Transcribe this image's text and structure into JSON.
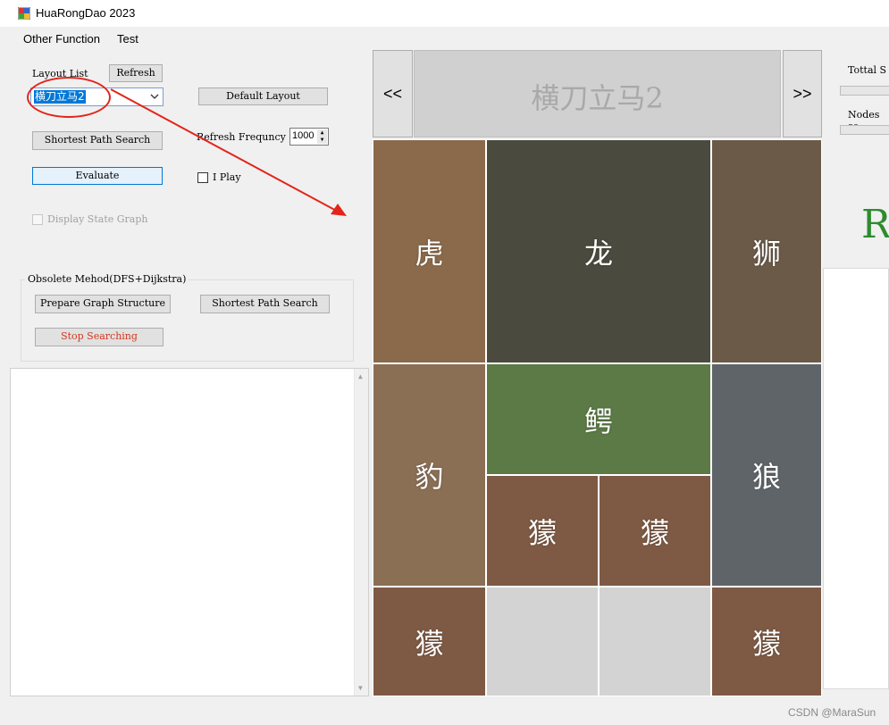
{
  "window": {
    "title": "HuaRongDao 2023"
  },
  "menu": {
    "items": [
      "Other Function",
      "Test"
    ]
  },
  "left": {
    "layout_list_label": "Layout List",
    "refresh_label": "Refresh",
    "layout_value": "横刀立马2",
    "default_layout_label": "Default Layout",
    "shortest_path_label": "Shortest Path Search",
    "refresh_freq_label": "Refresh Frequncy",
    "refresh_freq_value": "1000",
    "evaluate_label": "Evaluate",
    "iplay_label": "I Play",
    "display_state_label": "Display State Graph",
    "obsolete_group_label": "Obsolete Mehod(DFS+Dijkstra)",
    "prepare_graph_label": "Prepare Graph Structure",
    "shortest_path2_label": "Shortest Path Search",
    "stop_label": "Stop Searching"
  },
  "board": {
    "prev_label": "<<",
    "next_label": ">>",
    "layout_title": "横刀立马2",
    "tiles": [
      {
        "id": "tiger",
        "glyph": "虎",
        "color": "#8a6a4a"
      },
      {
        "id": "dragon",
        "glyph": "龙",
        "color": "#4b4a3e"
      },
      {
        "id": "lion",
        "glyph": "狮",
        "color": "#6b5a48"
      },
      {
        "id": "leopard",
        "glyph": "豹",
        "color": "#8a6f55"
      },
      {
        "id": "crocodile",
        "glyph": "鳄",
        "color": "#5b7a45"
      },
      {
        "id": "wolf",
        "glyph": "狼",
        "color": "#5e6468"
      },
      {
        "id": "fox1",
        "glyph": "獴",
        "color": "#7e5a44"
      },
      {
        "id": "fox2",
        "glyph": "獴",
        "color": "#7e5a44"
      },
      {
        "id": "fox3",
        "glyph": "獴",
        "color": "#7e5a44"
      },
      {
        "id": "fox4",
        "glyph": "獴",
        "color": "#7e5a44"
      }
    ]
  },
  "right": {
    "total_label": "Tottal S",
    "nodes_label": "Nodes se",
    "big_letter": "R"
  },
  "watermark": "CSDN @MaraSun"
}
